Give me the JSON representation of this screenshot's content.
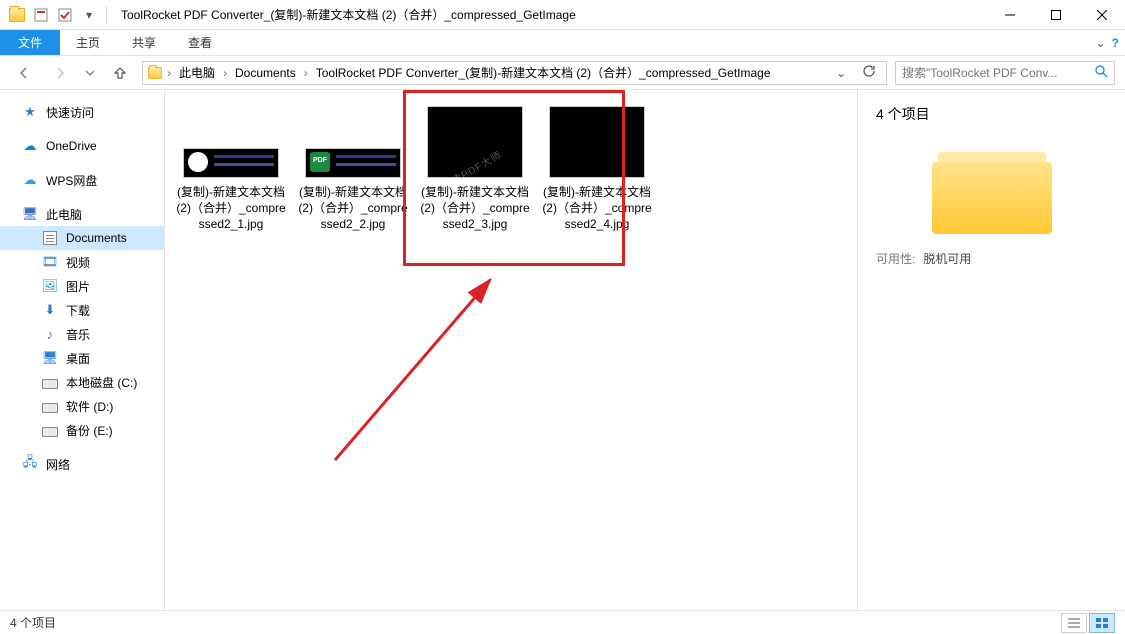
{
  "window": {
    "title": "ToolRocket PDF Converter_(复制)-新建文本文档 (2)（合并）_compressed_GetImage"
  },
  "ribbon": {
    "file_tab": "文件",
    "tabs": [
      "主页",
      "共享",
      "查看"
    ]
  },
  "breadcrumb": {
    "items": [
      "此电脑",
      "Documents",
      "ToolRocket PDF Converter_(复制)-新建文本文档 (2)（合并）_compressed_GetImage"
    ]
  },
  "search": {
    "placeholder": "搜索\"ToolRocket PDF Conv..."
  },
  "sidebar": {
    "quick_access": "快速访问",
    "onedrive": "OneDrive",
    "wps": "WPS网盘",
    "this_pc": "此电脑",
    "documents": "Documents",
    "videos": "视频",
    "pictures": "图片",
    "downloads": "下载",
    "music": "音乐",
    "desktop": "桌面",
    "drive_c": "本地磁盘 (C:)",
    "drive_d": "软件 (D:)",
    "drive_e": "备份 (E:)",
    "network": "网络"
  },
  "files": [
    {
      "name": "(复制)-新建文本文档 (2)（合并）_compressed2_1.jpg",
      "style": "small-white"
    },
    {
      "name": "(复制)-新建文本文档 (2)（合并）_compressed2_2.jpg",
      "style": "small-green"
    },
    {
      "name": "(复制)-新建文本文档 (2)（合并）_compressed2_3.jpg",
      "style": "big",
      "watermark": "迅读PDF大师"
    },
    {
      "name": "(复制)-新建文本文档 (2)（合并）_compressed2_4.jpg",
      "style": "big"
    }
  ],
  "details": {
    "title": "4 个项目",
    "avail_label": "可用性:",
    "avail_value": "脱机可用"
  },
  "status": {
    "count": "4 个项目"
  }
}
